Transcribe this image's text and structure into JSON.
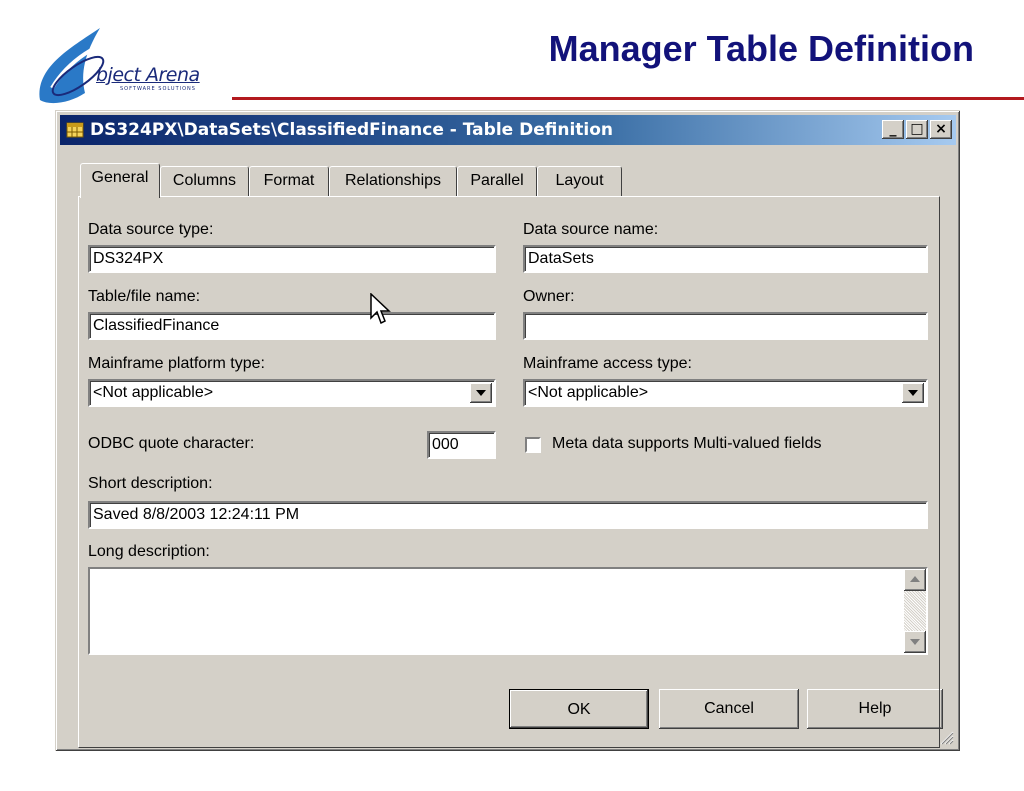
{
  "slide": {
    "logo_text": "bject Arena",
    "logo_subtext": "SOFTWARE SOLUTIONS",
    "title": "Manager Table Definition"
  },
  "window": {
    "title": "DS324PX\\DataSets\\ClassifiedFinance - Table Definition",
    "controls": {
      "minimize": "_",
      "maximize": "□",
      "close": "×"
    }
  },
  "tabs": [
    {
      "label": "General",
      "active": true
    },
    {
      "label": "Columns"
    },
    {
      "label": "Format"
    },
    {
      "label": "Relationships"
    },
    {
      "label": "Parallel"
    },
    {
      "label": "Layout"
    }
  ],
  "form": {
    "data_source_type": {
      "label": "Data source type:",
      "value": "DS324PX"
    },
    "data_source_name": {
      "label": "Data source name:",
      "value": "DataSets"
    },
    "table_file_name": {
      "label": "Table/file name:",
      "value": "ClassifiedFinance"
    },
    "owner": {
      "label": "Owner:",
      "value": ""
    },
    "mainframe_platform_type": {
      "label": "Mainframe platform type:",
      "value": "<Not applicable>"
    },
    "mainframe_access_type": {
      "label": "Mainframe access type:",
      "value": "<Not applicable>"
    },
    "odbc_quote_character": {
      "label": "ODBC quote character:",
      "value": "000"
    },
    "meta_multivalued": {
      "label": "Meta data supports Multi-valued fields",
      "checked": false
    },
    "short_description": {
      "label": "Short description:",
      "value": "Saved 8/8/2003 12:24:11 PM"
    },
    "long_description": {
      "label": "Long description:",
      "value": ""
    }
  },
  "buttons": {
    "ok": "OK",
    "cancel": "Cancel",
    "help": "Help"
  },
  "colors": {
    "title_blue": "#12127a",
    "rule_red": "#b3191e",
    "titlebar_start": "#0a246a",
    "titlebar_end": "#a6caf0"
  }
}
